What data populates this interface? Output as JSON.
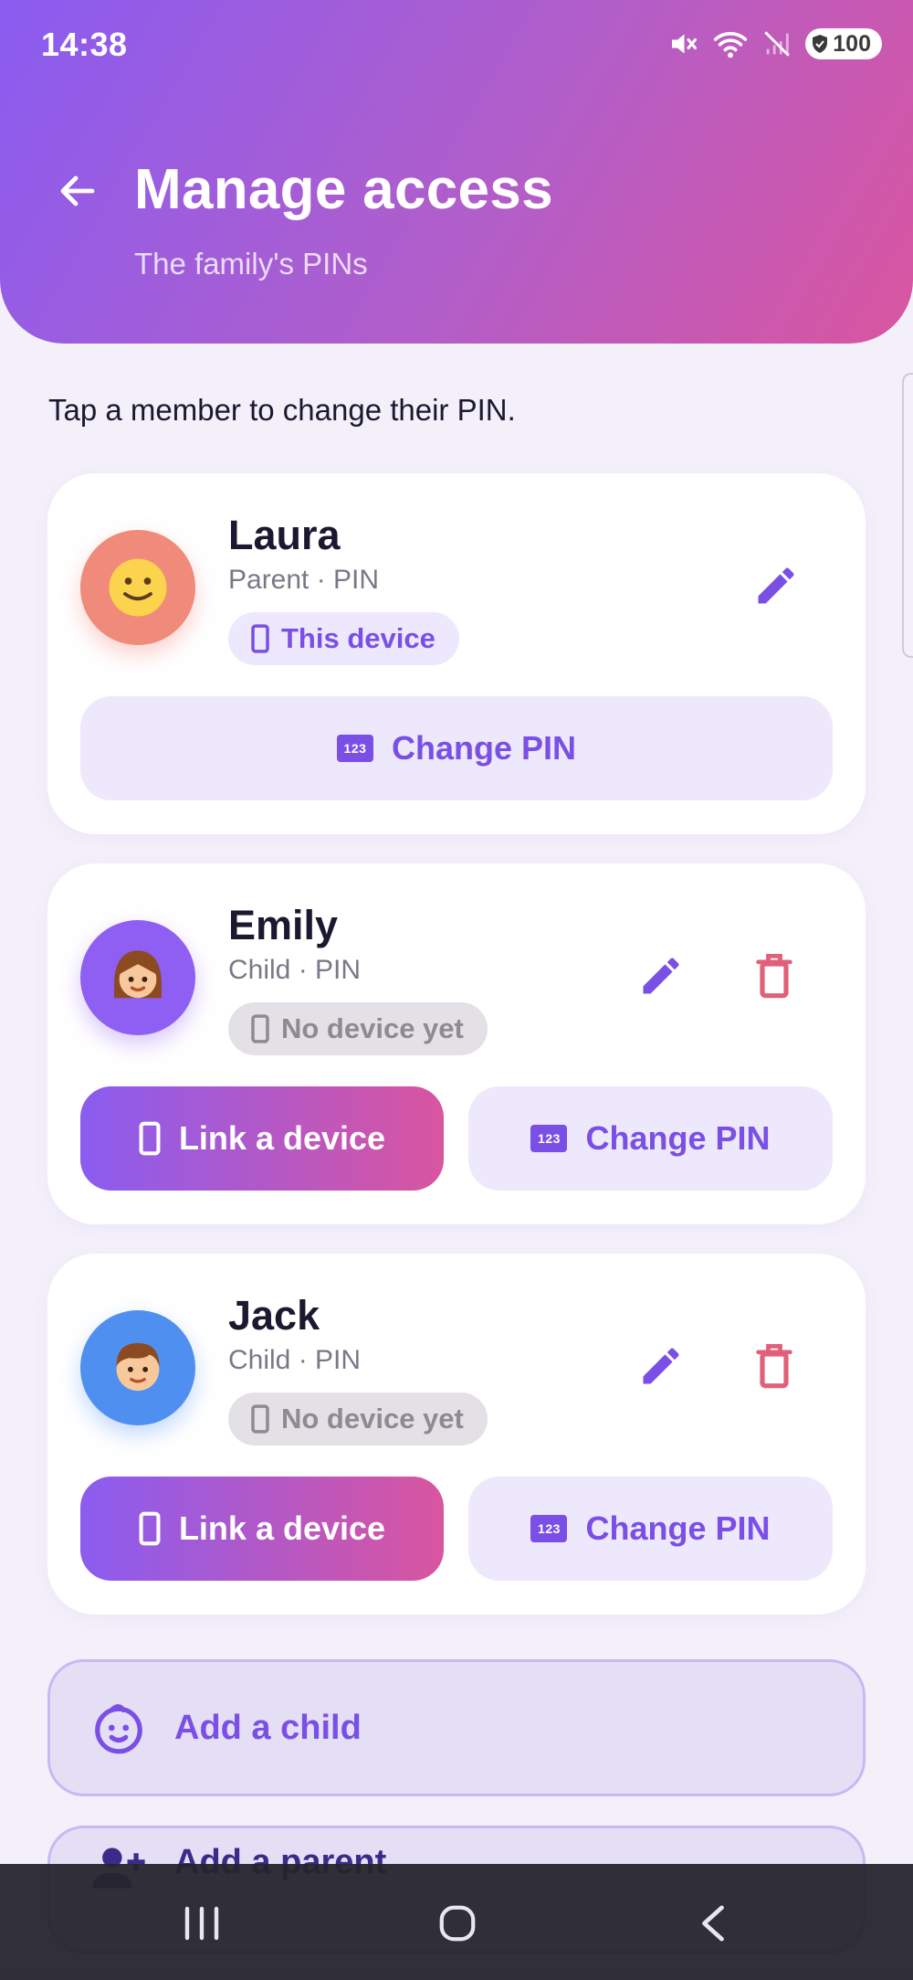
{
  "status_bar": {
    "time": "14:38",
    "battery": "100"
  },
  "header": {
    "title": "Manage access",
    "subtitle": "The family's PINs"
  },
  "intro": "Tap a member to change their PIN.",
  "members": [
    {
      "name": "Laura",
      "role": "Parent · PIN",
      "device": "This device",
      "change_pin_label": "Change PIN",
      "avatar_color": "#f08a7a"
    },
    {
      "name": "Emily",
      "role": "Child · PIN",
      "device": "No device yet",
      "link_label": "Link a device",
      "change_pin_label": "Change PIN",
      "avatar_color": "#8f5ef2"
    },
    {
      "name": "Jack",
      "role": "Child · PIN",
      "device": "No device yet",
      "link_label": "Link a device",
      "change_pin_label": "Change PIN",
      "avatar_color": "#4f8ff0"
    }
  ],
  "actions": {
    "add_child": "Add a child",
    "add_parent": "Add a parent"
  },
  "pin_icon_text": "123",
  "colors": {
    "accent": "#7a4fe6",
    "danger": "#e0607a",
    "gradient_start": "#8a5cf0",
    "gradient_end": "#d9559f"
  }
}
